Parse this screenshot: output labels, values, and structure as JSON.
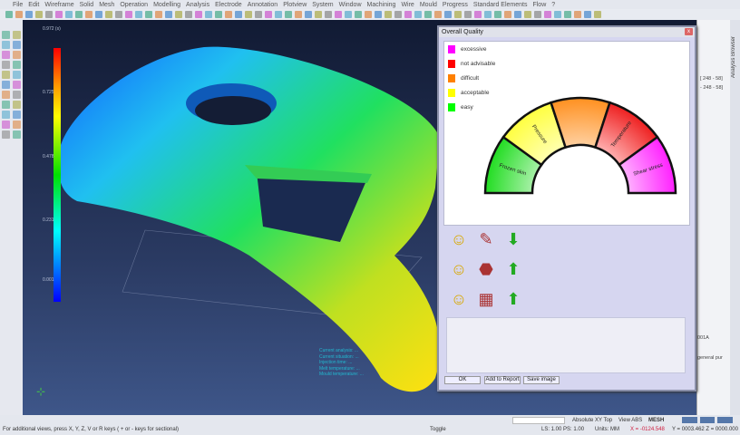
{
  "menu": [
    "File",
    "Edit",
    "Wireframe",
    "Solid",
    "Mesh",
    "Operation",
    "Modelling",
    "Analysis",
    "Electrode",
    "Annotation",
    "Plotview",
    "System",
    "Window",
    "Machining",
    "Wire",
    "Mould",
    "Progress",
    "Standard Elements",
    "Flow",
    "?"
  ],
  "legend_scale": {
    "max": "0.972 (s)",
    "v2": "0.725",
    "v3": "0.478",
    "v4": "0.231",
    "min": "0.001"
  },
  "viewport_info": [
    "Current analysis: ...",
    "Current situation: ...",
    "Injection time: ...",
    "Melt temperature: ...",
    "Mould temperature: ..."
  ],
  "dialog": {
    "title": "Overall Quality",
    "close": "x",
    "legend": [
      {
        "label": "excessive",
        "color": "#ff00ff"
      },
      {
        "label": "not advisable",
        "color": "#ff0000"
      },
      {
        "label": "difficult",
        "color": "#ff8000"
      },
      {
        "label": "acceptable",
        "color": "#ffff00"
      },
      {
        "label": "easy",
        "color": "#00ff00"
      }
    ],
    "gauge": {
      "segments": [
        {
          "color": "#22dd22",
          "light": "#a8f0a8"
        },
        {
          "color": "#ffff40",
          "light": "#ffffb0"
        },
        {
          "color": "#ff9020",
          "light": "#ffd0a0"
        },
        {
          "color": "#ee2020",
          "light": "#ffb0b0"
        },
        {
          "color": "#ff20ff",
          "light": "#ffb0ff"
        }
      ],
      "markers": [
        {
          "label": "Frozen skin",
          "segment": 0
        },
        {
          "label": "Pressure",
          "segment": 1
        },
        {
          "label": "Temperature",
          "segment": 3
        },
        {
          "label": "Shear stress",
          "segment": 4
        }
      ]
    },
    "rows": [
      {
        "trend": "down"
      },
      {
        "trend": "up"
      },
      {
        "trend": "up"
      }
    ],
    "buttons": {
      "ok": "OK",
      "report": "Add to Report",
      "save": "Save image"
    }
  },
  "right_panel": {
    "l1": "[ 248 - 58]",
    "l2": "- 248 - 58]",
    "l3": "001A",
    "l4": "general pur",
    "tab": "Analysis Browser"
  },
  "status": {
    "hint": "For additional views, press X, Y, Z, V or R keys ( + or - keys for sectional)",
    "view": "Absolute XY Top",
    "viewabs": "View ABS",
    "mode": "MESH",
    "toggle": "Toggle",
    "ls": "LS: 1.00 PS: 1.00",
    "units": "Units: MM",
    "x": "X = -0124.548",
    "yz": "Y = 0003.462 Z = 0000.000"
  }
}
